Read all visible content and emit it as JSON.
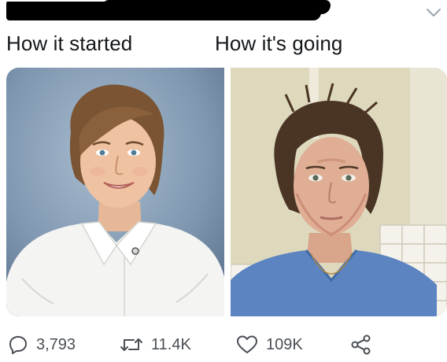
{
  "tweet": {
    "captions": {
      "left": "How it started",
      "right": "How it's going"
    },
    "photos": {
      "left_icon": "portrait-photo",
      "right_icon": "portrait-photo"
    },
    "actions": {
      "reply_count": "3,793",
      "retweet_count": "11.4K",
      "like_count": "109K"
    }
  },
  "colors": {
    "text": "#14171a",
    "icon_gray": "#4a4f55",
    "chevron_gray": "#9aa4ad",
    "redaction": "#000000"
  }
}
